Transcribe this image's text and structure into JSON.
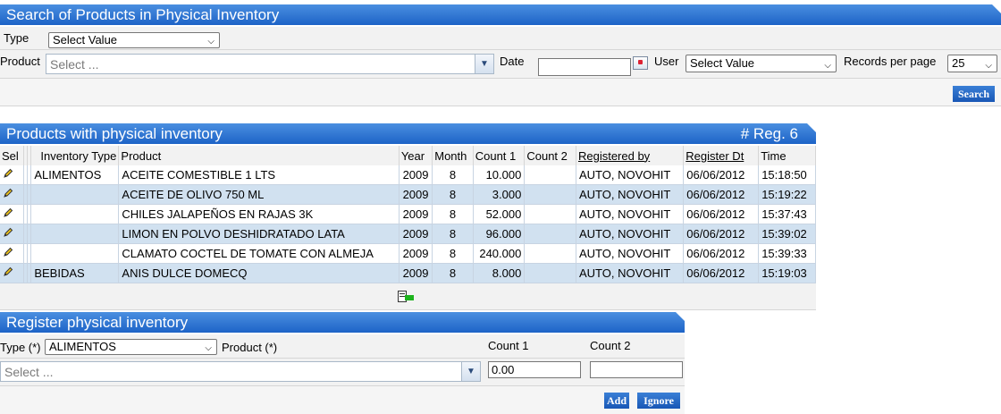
{
  "search": {
    "title": "Search of Products in Physical Inventory",
    "type_label": "Type",
    "type_value": "Select Value",
    "product_label": "Product",
    "product_placeholder": "Select ...",
    "date_label": "Date",
    "date_value": "",
    "user_label": "User",
    "user_value": "Select Value",
    "records_label": "Records per page",
    "records_value": "25",
    "search_button": "Search"
  },
  "products": {
    "title": "Products with physical inventory",
    "reg_count": "# Reg. 6",
    "columns": [
      "Sel",
      "Inventory Type",
      "Product",
      "Year",
      "Month",
      "Count 1",
      "Count 2",
      "Registered by",
      "Register Dt",
      "Time"
    ],
    "rows": [
      {
        "type": "ALIMENTOS",
        "product": "ACEITE COMESTIBLE 1 LTS",
        "year": "2009",
        "month": "8",
        "count1": "10.000",
        "count2": "",
        "registered_by": "AUTO, NOVOHIT",
        "date": "06/06/2012",
        "time": "15:18:50"
      },
      {
        "type": "",
        "product": "ACEITE DE OLIVO 750 ML",
        "year": "2009",
        "month": "8",
        "count1": "3.000",
        "count2": "",
        "registered_by": "AUTO, NOVOHIT",
        "date": "06/06/2012",
        "time": "15:19:22"
      },
      {
        "type": "",
        "product": "CHILES JALAPEÑOS EN RAJAS 3K",
        "year": "2009",
        "month": "8",
        "count1": "52.000",
        "count2": "",
        "registered_by": "AUTO, NOVOHIT",
        "date": "06/06/2012",
        "time": "15:37:43"
      },
      {
        "type": "",
        "product": "LIMON EN POLVO DESHIDRATADO LATA",
        "year": "2009",
        "month": "8",
        "count1": "96.000",
        "count2": "",
        "registered_by": "AUTO, NOVOHIT",
        "date": "06/06/2012",
        "time": "15:39:02"
      },
      {
        "type": "",
        "product": "CLAMATO COCTEL DE TOMATE CON ALMEJA",
        "year": "2009",
        "month": "8",
        "count1": "240.000",
        "count2": "",
        "registered_by": "AUTO, NOVOHIT",
        "date": "06/06/2012",
        "time": "15:39:33"
      },
      {
        "type": "BEBIDAS",
        "product": "ANIS DULCE DOMECQ",
        "year": "2009",
        "month": "8",
        "count1": "8.000",
        "count2": "",
        "registered_by": "AUTO, NOVOHIT",
        "date": "06/06/2012",
        "time": "15:19:03"
      }
    ]
  },
  "register": {
    "title": "Register physical inventory",
    "type_label": "Type (*)",
    "type_value": "ALIMENTOS",
    "product_label": "Product (*)",
    "count1_label": "Count 1",
    "count2_label": "Count 2",
    "product_placeholder": "Select ...",
    "count1_value": "0.00",
    "count2_value": "",
    "add_button": "Add",
    "ignore_button": "Ignore"
  },
  "icons": {
    "edit": "pencil-icon",
    "calendar": "calendar-icon",
    "export": "export-icon"
  },
  "colors": {
    "header_blue": "#1d63c7",
    "row_alt": "#d1e1f0"
  }
}
